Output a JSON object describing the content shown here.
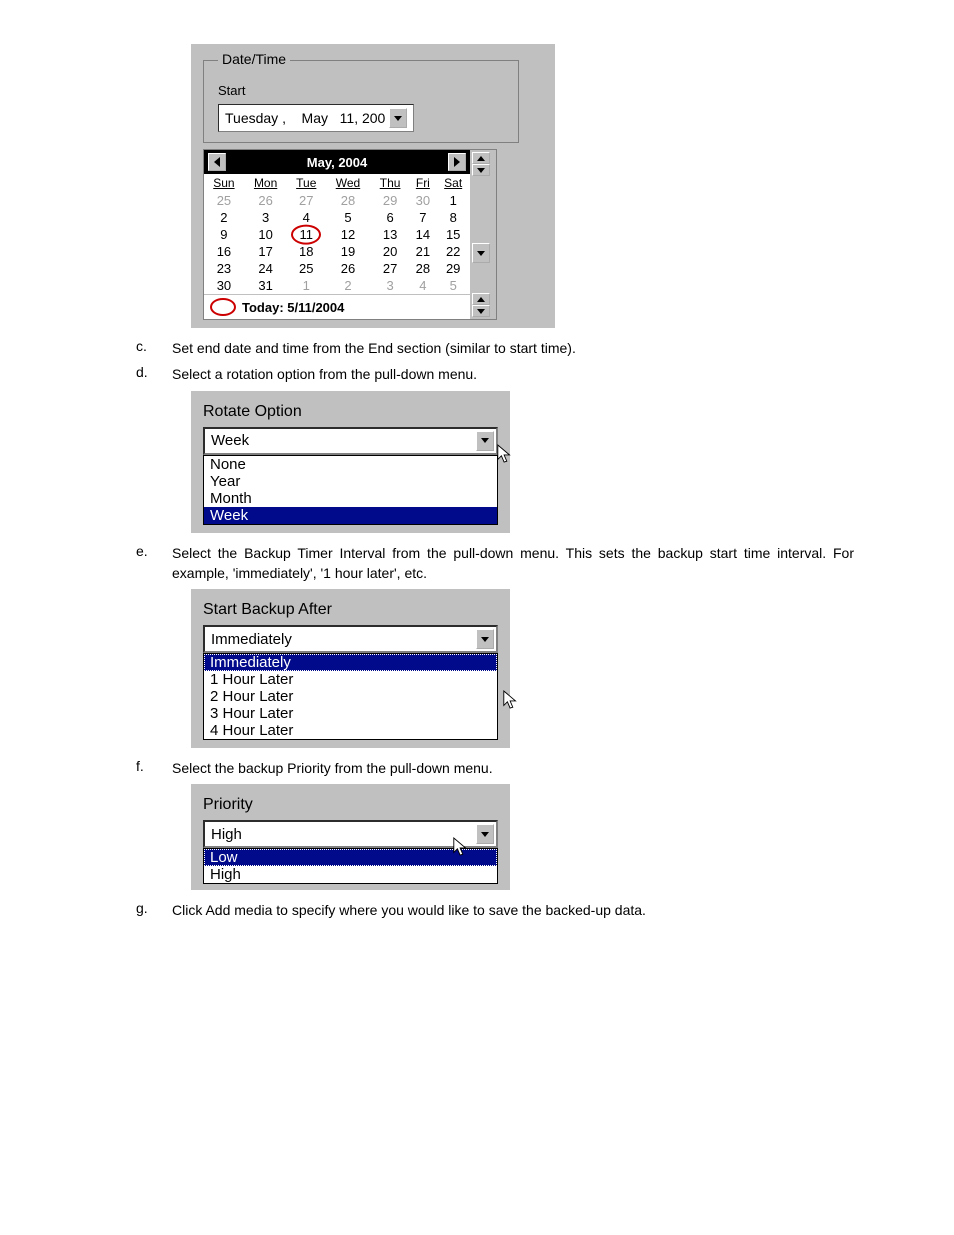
{
  "dateTime": {
    "legend": "Date/Time",
    "startLabel": "Start",
    "dateField": {
      "weekday": "Tuesday",
      "sep": " ,    ",
      "month": "May",
      "day": "11,",
      "year": "200"
    },
    "calendar": {
      "title": "May, 2004",
      "days": [
        "Sun",
        "Mon",
        "Tue",
        "Wed",
        "Thu",
        "Fri",
        "Sat"
      ],
      "rows": [
        [
          {
            "v": "25",
            "o": true
          },
          {
            "v": "26",
            "o": true
          },
          {
            "v": "27",
            "o": true
          },
          {
            "v": "28",
            "o": true
          },
          {
            "v": "29",
            "o": true
          },
          {
            "v": "30",
            "o": true
          },
          {
            "v": "1"
          }
        ],
        [
          {
            "v": "2"
          },
          {
            "v": "3"
          },
          {
            "v": "4"
          },
          {
            "v": "5"
          },
          {
            "v": "6"
          },
          {
            "v": "7"
          },
          {
            "v": "8"
          }
        ],
        [
          {
            "v": "9"
          },
          {
            "v": "10"
          },
          {
            "v": "11",
            "today": true
          },
          {
            "v": "12"
          },
          {
            "v": "13"
          },
          {
            "v": "14"
          },
          {
            "v": "15"
          }
        ],
        [
          {
            "v": "16"
          },
          {
            "v": "17"
          },
          {
            "v": "18"
          },
          {
            "v": "19"
          },
          {
            "v": "20"
          },
          {
            "v": "21"
          },
          {
            "v": "22"
          }
        ],
        [
          {
            "v": "23"
          },
          {
            "v": "24"
          },
          {
            "v": "25"
          },
          {
            "v": "26"
          },
          {
            "v": "27"
          },
          {
            "v": "28"
          },
          {
            "v": "29"
          }
        ],
        [
          {
            "v": "30"
          },
          {
            "v": "31"
          },
          {
            "v": "1",
            "o": true
          },
          {
            "v": "2",
            "o": true
          },
          {
            "v": "3",
            "o": true
          },
          {
            "v": "4",
            "o": true
          },
          {
            "v": "5",
            "o": true
          }
        ]
      ],
      "todayText": "Today: 5/11/2004"
    }
  },
  "steps": {
    "c": {
      "m": "c.",
      "t": "Set end date and time from the End section (similar to start time)."
    },
    "d": {
      "m": "d.",
      "t": "Select a rotation option from the pull-down menu."
    },
    "e": {
      "m": "e.",
      "t": "Select the Backup Timer Interval from the pull-down menu. This sets the backup start time interval. For example, 'immediately', '1 hour later', etc."
    },
    "f": {
      "m": "f.",
      "t": "Select the backup Priority from the pull-down menu."
    },
    "g": {
      "m": "g.",
      "t": "Click Add media to specify where you would like to save the backed-up data."
    }
  },
  "rotate": {
    "title": "Rotate Option",
    "value": "Week",
    "options": [
      "None",
      "Year",
      "Month",
      "Week"
    ],
    "selectedIndex": 3
  },
  "backupAfter": {
    "title": "Start Backup After",
    "value": "Immediately",
    "options": [
      "Immediately",
      "1 Hour Later",
      "2 Hour Later",
      "3 Hour Later",
      "4 Hour Later"
    ],
    "selectedIndex": 0
  },
  "priority": {
    "title": "Priority",
    "value": "High",
    "options": [
      "Low",
      "High"
    ],
    "selectedIndex": 0
  }
}
